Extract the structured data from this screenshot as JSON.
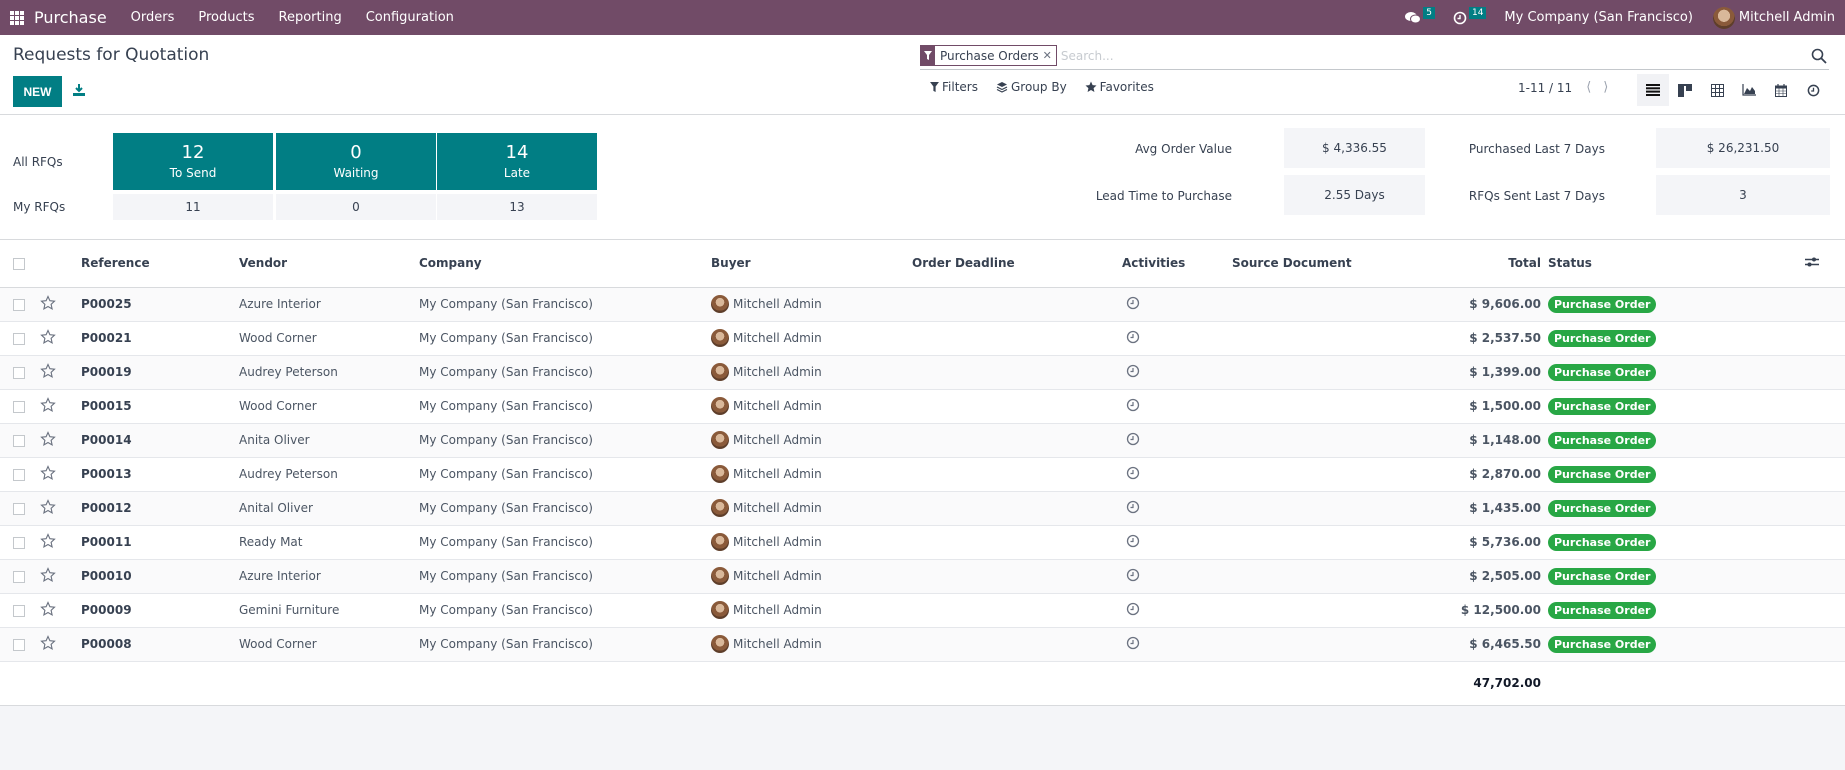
{
  "navbar": {
    "brand": "Purchase",
    "menu": [
      "Orders",
      "Products",
      "Reporting",
      "Configuration"
    ],
    "messages_count": "5",
    "activities_count": "14",
    "company": "My Company (San Francisco)",
    "user": "Mitchell Admin"
  },
  "control_panel": {
    "title": "Requests for Quotation",
    "new_label": "NEW",
    "facet_label": "Purchase Orders",
    "search_placeholder": "Search...",
    "filters_label": "Filters",
    "groupby_label": "Group By",
    "favorites_label": "Favorites",
    "pager": "1-11 / 11",
    "views": [
      "list",
      "kanban",
      "pivot",
      "graph",
      "calendar",
      "activity"
    ],
    "active_view": "list"
  },
  "dashboard": {
    "row_labels": [
      "All RFQs",
      "My RFQs"
    ],
    "tiles": [
      {
        "count": "12",
        "label": "To Send",
        "mine": "11"
      },
      {
        "count": "0",
        "label": "Waiting",
        "mine": "0"
      },
      {
        "count": "14",
        "label": "Late",
        "mine": "13"
      }
    ],
    "kpis": [
      {
        "label": "Avg Order Value",
        "value": "$ 4,336.55"
      },
      {
        "label": "Lead Time to Purchase",
        "value": "2.55 Days"
      },
      {
        "label": "Purchased Last 7 Days",
        "value": "$ 26,231.50"
      },
      {
        "label": "RFQs Sent Last 7 Days",
        "value": "3"
      }
    ]
  },
  "table": {
    "columns": [
      "Reference",
      "Vendor",
      "Company",
      "Buyer",
      "Order Deadline",
      "Activities",
      "Source Document",
      "Total",
      "Status"
    ],
    "rows": [
      {
        "reference": "P00025",
        "vendor": "Azure Interior",
        "company": "My Company (San Francisco)",
        "buyer": "Mitchell Admin",
        "deadline": "",
        "source": "",
        "total": "$ 9,606.00",
        "status": "Purchase Order"
      },
      {
        "reference": "P00021",
        "vendor": "Wood Corner",
        "company": "My Company (San Francisco)",
        "buyer": "Mitchell Admin",
        "deadline": "",
        "source": "",
        "total": "$ 2,537.50",
        "status": "Purchase Order"
      },
      {
        "reference": "P00019",
        "vendor": "Audrey Peterson",
        "company": "My Company (San Francisco)",
        "buyer": "Mitchell Admin",
        "deadline": "",
        "source": "",
        "total": "$ 1,399.00",
        "status": "Purchase Order"
      },
      {
        "reference": "P00015",
        "vendor": "Wood Corner",
        "company": "My Company (San Francisco)",
        "buyer": "Mitchell Admin",
        "deadline": "",
        "source": "",
        "total": "$ 1,500.00",
        "status": "Purchase Order"
      },
      {
        "reference": "P00014",
        "vendor": "Anita Oliver",
        "company": "My Company (San Francisco)",
        "buyer": "Mitchell Admin",
        "deadline": "",
        "source": "",
        "total": "$ 1,148.00",
        "status": "Purchase Order"
      },
      {
        "reference": "P00013",
        "vendor": "Audrey Peterson",
        "company": "My Company (San Francisco)",
        "buyer": "Mitchell Admin",
        "deadline": "",
        "source": "",
        "total": "$ 2,870.00",
        "status": "Purchase Order"
      },
      {
        "reference": "P00012",
        "vendor": "Anital Oliver",
        "company": "My Company (San Francisco)",
        "buyer": "Mitchell Admin",
        "deadline": "",
        "source": "",
        "total": "$ 1,435.00",
        "status": "Purchase Order"
      },
      {
        "reference": "P00011",
        "vendor": "Ready Mat",
        "company": "My Company (San Francisco)",
        "buyer": "Mitchell Admin",
        "deadline": "",
        "source": "",
        "total": "$ 5,736.00",
        "status": "Purchase Order"
      },
      {
        "reference": "P00010",
        "vendor": "Azure Interior",
        "company": "My Company (San Francisco)",
        "buyer": "Mitchell Admin",
        "deadline": "",
        "source": "",
        "total": "$ 2,505.00",
        "status": "Purchase Order"
      },
      {
        "reference": "P00009",
        "vendor": "Gemini Furniture",
        "company": "My Company (San Francisco)",
        "buyer": "Mitchell Admin",
        "deadline": "",
        "source": "",
        "total": "$ 12,500.00",
        "status": "Purchase Order"
      },
      {
        "reference": "P00008",
        "vendor": "Wood Corner",
        "company": "My Company (San Francisco)",
        "buyer": "Mitchell Admin",
        "deadline": "",
        "source": "",
        "total": "$ 6,465.50",
        "status": "Purchase Order"
      }
    ],
    "sum_total": "47,702.00"
  },
  "colors": {
    "brand": "#714b67",
    "accent": "#017e84",
    "status_success": "#28a745"
  }
}
